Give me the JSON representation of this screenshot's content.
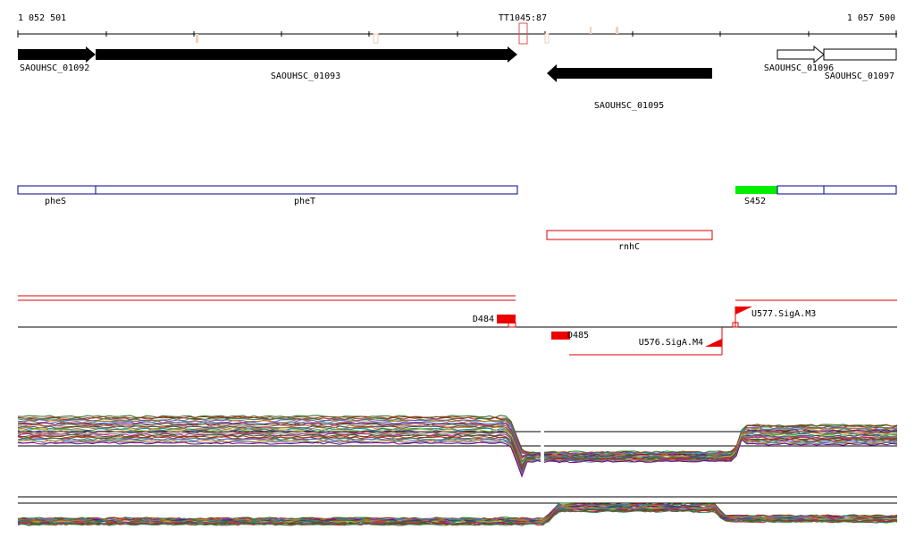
{
  "coords": {
    "left": "1 052 501",
    "right": "1 057 500",
    "marker": "TT1045:87"
  },
  "genes": [
    {
      "id": "gene-SAOUHSC_01092",
      "label": "SAOUHSC_01092",
      "strand": "+",
      "style": "filled"
    },
    {
      "id": "gene-SAOUHSC_01093",
      "label": "SAOUHSC_01093",
      "strand": "+",
      "style": "filled"
    },
    {
      "id": "gene-SAOUHSC_01095",
      "label": "SAOUHSC_01095",
      "strand": "-",
      "style": "filled"
    },
    {
      "id": "gene-SAOUHSC_01096",
      "label": "SAOUHSC_01096",
      "strand": "+",
      "style": "outline"
    },
    {
      "id": "gene-SAOUHSC_01097",
      "label": "SAOUHSC_01097",
      "strand": "+",
      "style": "outline"
    }
  ],
  "annotations": {
    "pheS": "pheS",
    "pheT": "pheT",
    "S452": "S452",
    "rnhC": "rnhC"
  },
  "features": {
    "D484": "D484",
    "D485": "D485",
    "U576": "U576.SigA.M4",
    "U577": "U577.SigA.M3"
  },
  "colors": {
    "gene_fill": "#000000",
    "annotation_outline": "#00008b",
    "s452_fill": "#00ee00",
    "rnhC_outline": "#dd0000",
    "feature_red": "#ee0000",
    "series_palette": [
      "#1a6b1a",
      "#8b4513",
      "#b22222",
      "#2e8b57",
      "#6a5acd",
      "#b8860b",
      "#4682b4",
      "#800080",
      "#556b2f",
      "#cd5c5c",
      "#2f4f4f",
      "#d2691e",
      "#008b8b",
      "#9acd32",
      "#483d8b",
      "#a0522d",
      "#708090",
      "#c71585"
    ]
  }
}
